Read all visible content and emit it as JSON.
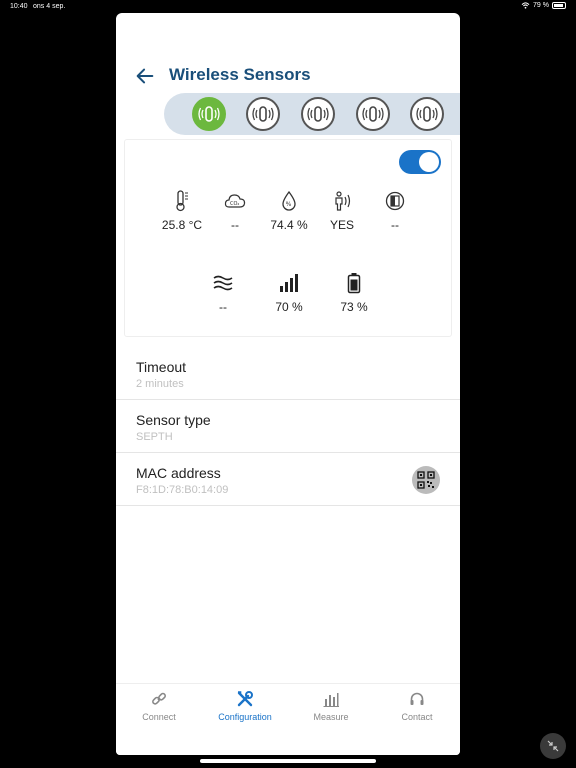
{
  "status": {
    "time": "10:40",
    "date": "ons 4 sep.",
    "battery": "79 %"
  },
  "header": {
    "title": "Wireless Sensors"
  },
  "sensors": [
    {
      "name": "sensor-1",
      "active": true
    },
    {
      "name": "sensor-2",
      "active": false
    },
    {
      "name": "sensor-3",
      "active": false
    },
    {
      "name": "sensor-4",
      "active": false
    },
    {
      "name": "sensor-5",
      "active": false
    }
  ],
  "card": {
    "enabled": true,
    "metrics_row1": [
      {
        "icon": "thermometer-icon",
        "value": "25.8 °C"
      },
      {
        "icon": "co2-icon",
        "value": "--"
      },
      {
        "icon": "humidity-icon",
        "value": "74.4 %"
      },
      {
        "icon": "presence-icon",
        "value": "YES"
      },
      {
        "icon": "door-icon",
        "value": "--"
      }
    ],
    "metrics_row2": [
      {
        "icon": "vibration-icon",
        "value": "--"
      },
      {
        "icon": "signal-icon",
        "value": "70 %"
      },
      {
        "icon": "battery-icon",
        "value": "73 %"
      }
    ]
  },
  "settings": [
    {
      "label": "Timeout",
      "value": "2 minutes"
    },
    {
      "label": "Sensor type",
      "value": "SEPTH"
    },
    {
      "label": "MAC address",
      "value": "F8:1D:78:B0:14:09"
    }
  ],
  "tabs": [
    {
      "label": "Connect",
      "icon": "link-icon",
      "active": false
    },
    {
      "label": "Configuration",
      "icon": "tools-icon",
      "active": true
    },
    {
      "label": "Measure",
      "icon": "bar-chart-icon",
      "active": false
    },
    {
      "label": "Contact",
      "icon": "headset-icon",
      "active": false
    }
  ],
  "colors": {
    "accent": "#1a73c8",
    "title": "#1a4f7a",
    "active_sensor": "#6cb83e"
  }
}
